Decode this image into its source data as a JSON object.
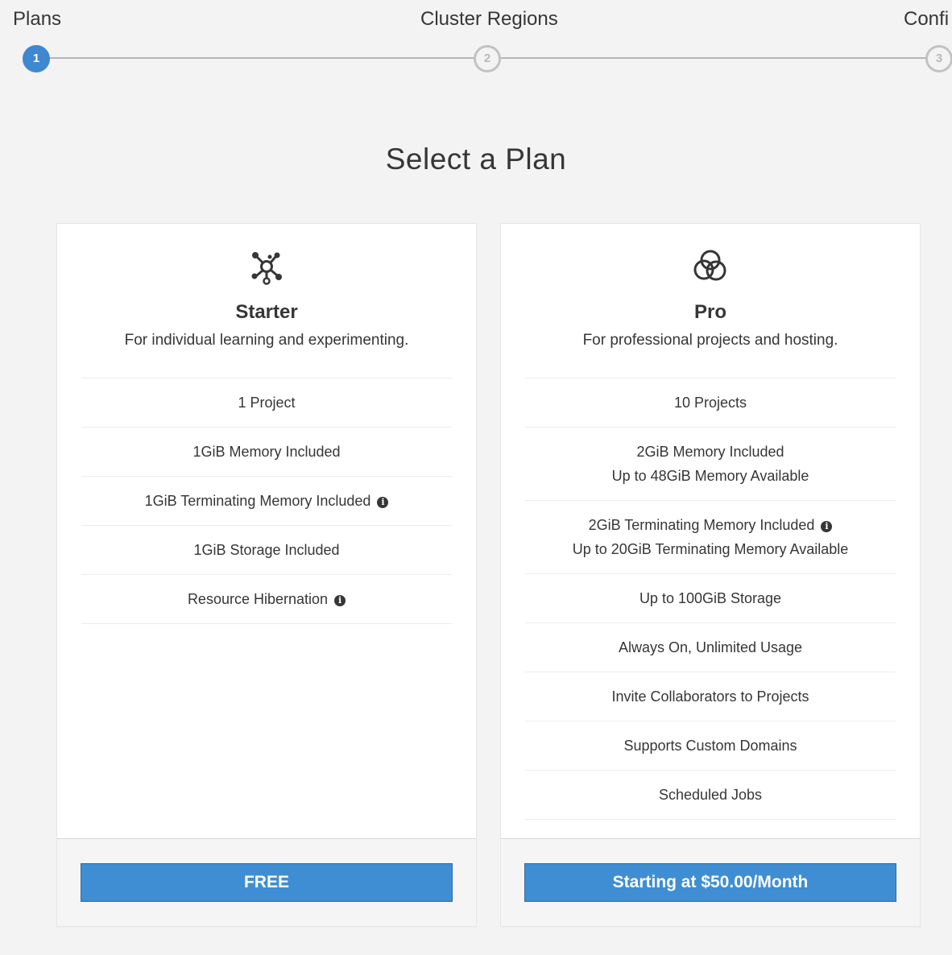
{
  "stepper": {
    "steps": [
      {
        "label": "Plans",
        "number": "1",
        "state": "active"
      },
      {
        "label": "Cluster Regions",
        "number": "2",
        "state": "pending"
      },
      {
        "label": "Confi",
        "number": "3",
        "state": "pending"
      }
    ]
  },
  "page": {
    "title": "Select a Plan"
  },
  "plans": [
    {
      "icon": "molecule-nodes-icon",
      "name": "Starter",
      "description": "For individual learning and experimenting.",
      "features": [
        {
          "text": "1 Project"
        },
        {
          "text": "1GiB Memory Included"
        },
        {
          "text": "1GiB Terminating Memory Included",
          "info": true
        },
        {
          "text": "1GiB Storage Included"
        },
        {
          "text": "Resource Hibernation",
          "info": true
        }
      ],
      "button_label": "FREE"
    },
    {
      "icon": "interlocking-circles-icon",
      "name": "Pro",
      "description": "For professional projects and hosting.",
      "features": [
        {
          "text": "10 Projects"
        },
        {
          "text": "2GiB Memory Included",
          "sub": "Up to 48GiB Memory Available"
        },
        {
          "text": "2GiB Terminating Memory Included",
          "info": true,
          "sub": "Up to 20GiB Terminating Memory Available"
        },
        {
          "text": "Up to 100GiB Storage"
        },
        {
          "text": "Always On, Unlimited Usage"
        },
        {
          "text": "Invite Collaborators to Projects"
        },
        {
          "text": "Supports Custom Domains"
        },
        {
          "text": "Scheduled Jobs"
        }
      ],
      "button_label": "Starting at $50.00/Month"
    }
  ],
  "colors": {
    "accent": "#3f87d0",
    "button": "#3f8ed3",
    "text": "#363636",
    "background": "#f3f3f3"
  }
}
